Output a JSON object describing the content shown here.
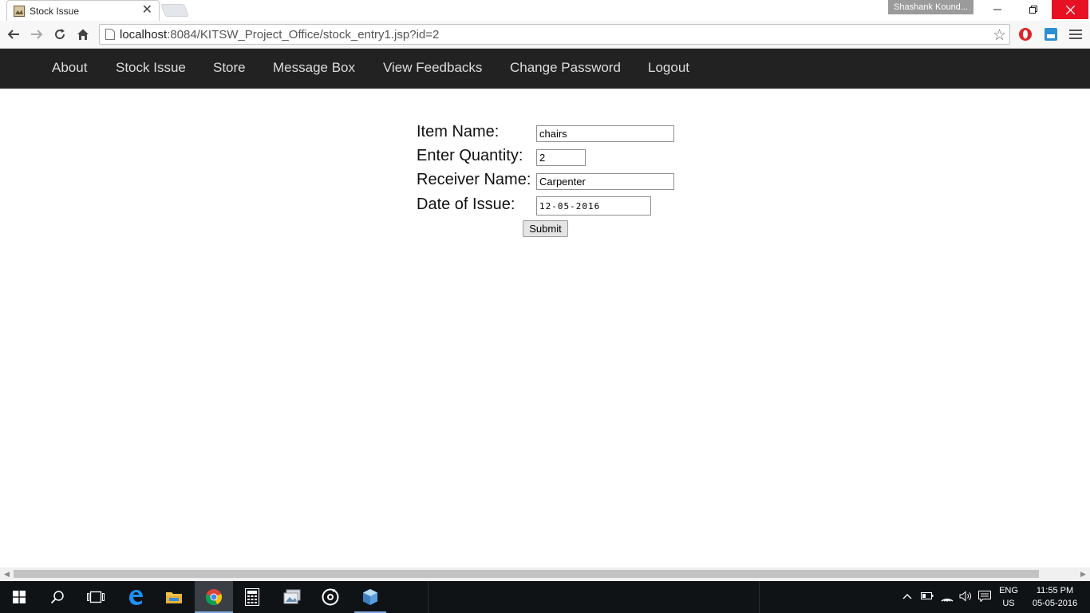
{
  "browser": {
    "tab_title": "Stock Issue",
    "tab_close": "✕",
    "profile_name": "Shashank Kound...",
    "url_host": "localhost",
    "url_rest": ":8084/KITSW_Project_Office/stock_entry1.jsp?id=2"
  },
  "site_nav": {
    "items": [
      "About",
      "Stock Issue",
      "Store",
      "Message Box",
      "View Feedbacks",
      "Change Password",
      "Logout"
    ]
  },
  "form": {
    "item_name_label": "Item Name:",
    "item_name_value": "chairs",
    "quantity_label": "Enter Quantity:",
    "quantity_value": "2",
    "receiver_label": "Receiver Name:",
    "receiver_value": "Carpenter",
    "date_label": "Date of Issue:",
    "date_value": "12-05-2016",
    "submit_label": "Submit"
  },
  "taskbar": {
    "apps": [
      "windows-start",
      "search",
      "task-view",
      "edge",
      "file-explorer",
      "chrome",
      "calculator",
      "photos",
      "groove-music",
      "virtualbox"
    ],
    "lang_line1": "ENG",
    "lang_line2": "US",
    "time": "11:55 PM",
    "date": "05-05-2016"
  },
  "colors": {
    "site_nav_bg": "#222222",
    "site_nav_text": "#dddddd",
    "close_red": "#e81123",
    "taskbar_bg": "#101316"
  }
}
